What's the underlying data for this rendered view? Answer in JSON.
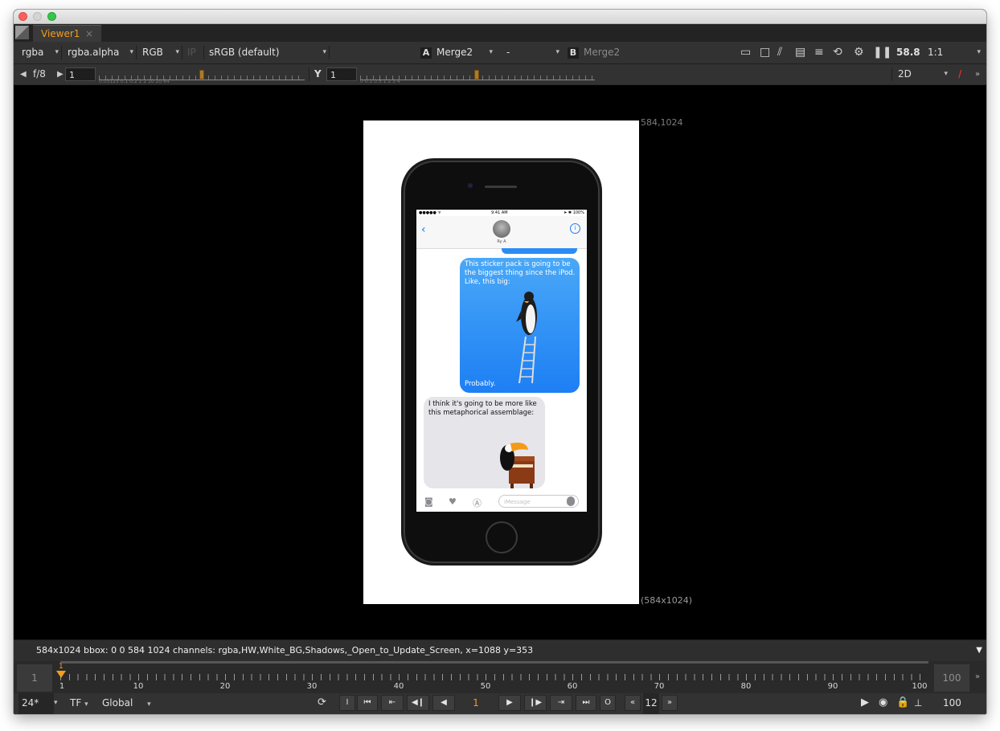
{
  "tab": {
    "title": "Viewer1",
    "close": "×"
  },
  "toolbar1": {
    "channels": "rgba",
    "alpha_channel": "rgba.alpha",
    "display": "RGB",
    "ip": "IP",
    "colorspace": "sRGB (default)",
    "a_label": "A",
    "a_input": "Merge2",
    "op": "-",
    "b_label": "B",
    "b_input": "Merge2",
    "fps": "58.8",
    "zoom": "1:1"
  },
  "toolbar2": {
    "fstop": "f/8",
    "gain_value": "1",
    "gamma_label": "Y",
    "gamma_value": "1",
    "gain_ticks": "0.03125   0.1   0.2        1    2         10   20   64",
    "gamma_ticks": "0          0.1          0.5          1          2          3        4",
    "view_mode": "2D"
  },
  "viewer": {
    "top_right_coord": "584,1024",
    "bottom_right_coord": "(584x1024)"
  },
  "phone": {
    "status_left": "●●●●● ᯤ",
    "status_time": "9:41 AM",
    "status_right": "➤ ✱ 100%",
    "contact": "Ry A",
    "msg_out": "This sticker pack is going to be the biggest thing since the iPod. Like, this big:",
    "msg_out_end": "Probably.",
    "msg_in": "I think it's going to be more like this metaphorical assemblage:",
    "compose_placeholder": "iMessage"
  },
  "status_line": "584x1024  bbox: 0 0 584 1024 channels: rgba,HW,White_BG,Shadows,_Open_to_Update_Screen,  x=1088 y=353",
  "timeline": {
    "in_frame": "1",
    "out_frame": "100",
    "current": "1",
    "labels": [
      "1",
      "10",
      "20",
      "30",
      "40",
      "50",
      "60",
      "70",
      "80",
      "90",
      "100"
    ]
  },
  "controls": {
    "fps": "24*",
    "timecode": "TF",
    "scope": "Global",
    "frame": "1",
    "step": "12",
    "end_frame": "100"
  }
}
